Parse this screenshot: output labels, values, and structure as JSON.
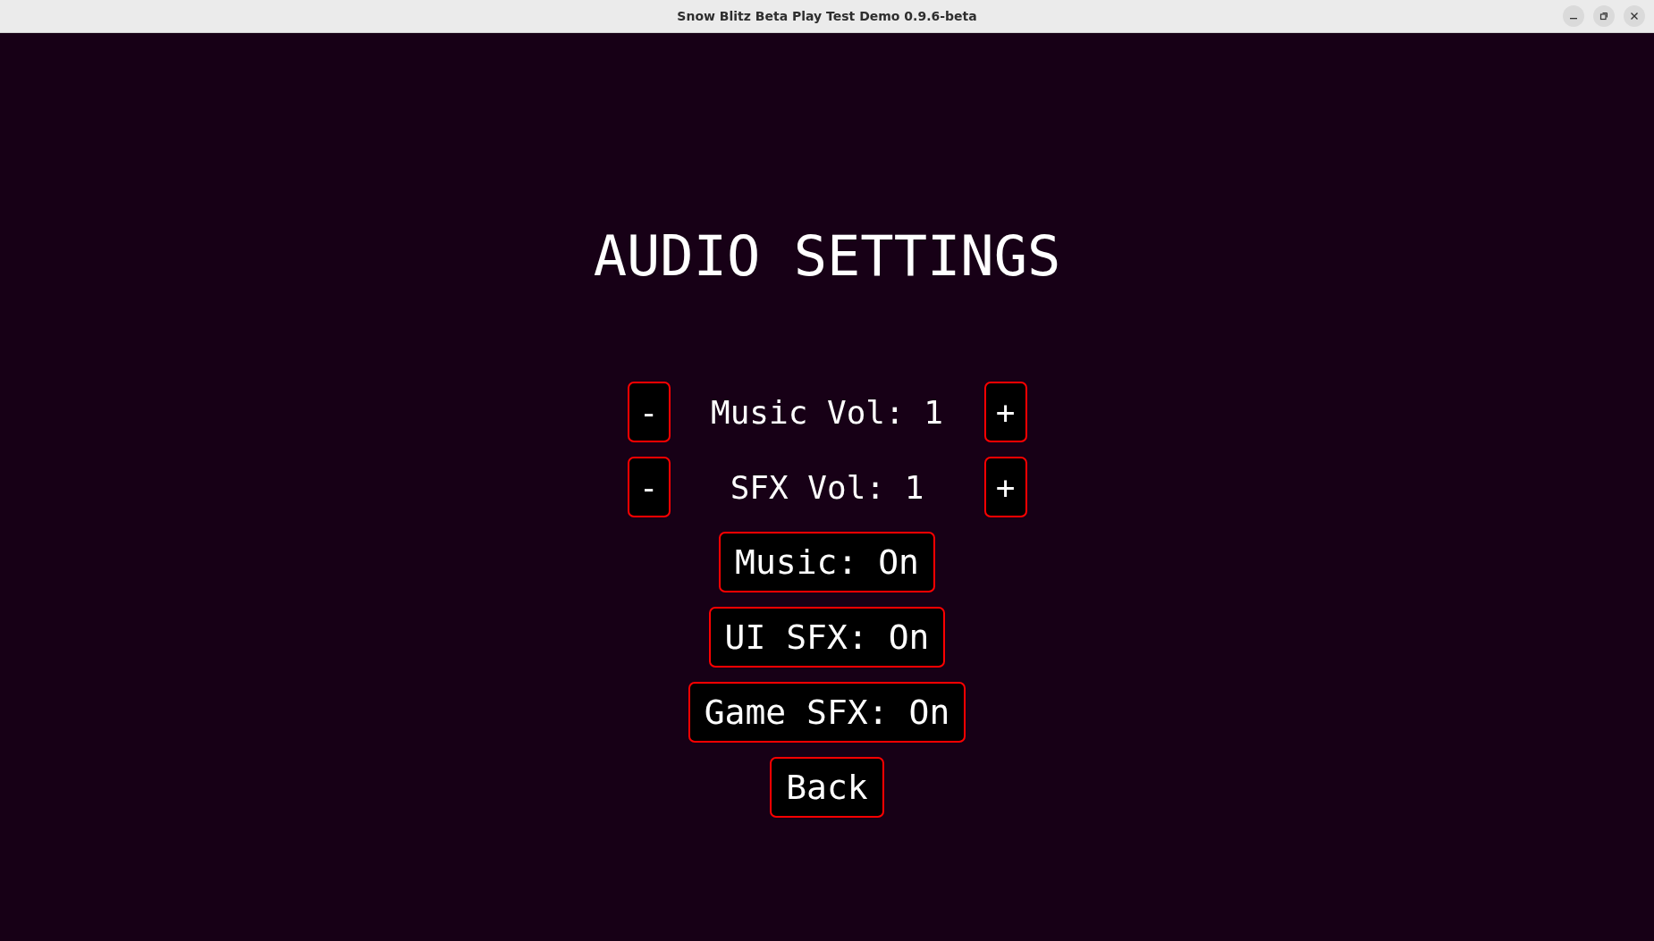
{
  "window": {
    "title": "Snow Blitz Beta Play Test Demo 0.9.6-beta"
  },
  "heading": "AUDIO SETTINGS",
  "volume_rows": [
    {
      "minus": "-",
      "label": "Music Vol: 1",
      "plus": "+"
    },
    {
      "minus": "-",
      "label": "SFX Vol: 1",
      "plus": "+"
    }
  ],
  "buttons": [
    "Music: On",
    "UI SFX: On",
    "Game SFX: On",
    "Back"
  ]
}
